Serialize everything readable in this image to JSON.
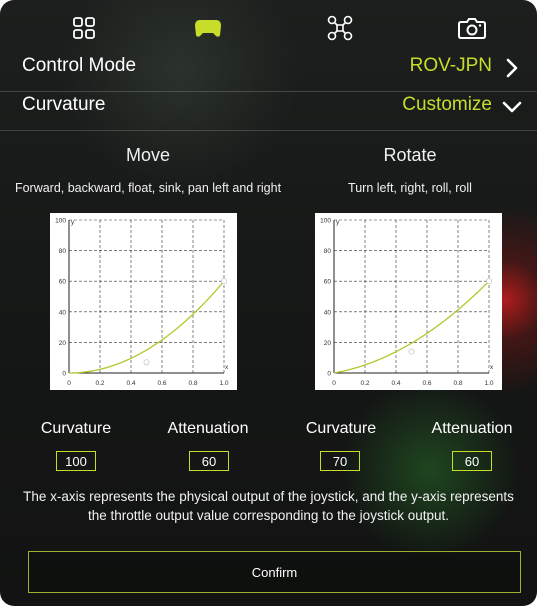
{
  "tabs": [
    {
      "icon": "grid-icon",
      "active": false
    },
    {
      "icon": "gamepad-icon",
      "active": true
    },
    {
      "icon": "drone-icon",
      "active": false
    },
    {
      "icon": "camera-icon",
      "active": false
    }
  ],
  "control_mode": {
    "label": "Control Mode",
    "value": "ROV-JPN"
  },
  "curvature_row": {
    "label": "Curvature",
    "value": "Customize"
  },
  "colors": {
    "accent": "#c8dd2a",
    "curve": "#b7c62b",
    "border": "#9fb02a"
  },
  "move_chart": {
    "title": "Move",
    "description": "Forward, backward, float, sink, pan left and right",
    "x_label": "x",
    "y_label": "y",
    "x_ticks": [
      "0",
      "0.2",
      "0.4",
      "0.6",
      "0.8",
      "1.0"
    ],
    "y_ticks": [
      "0",
      "20",
      "40",
      "60",
      "80",
      "100"
    ],
    "curvature": 100,
    "attenuation": 60,
    "marker": {
      "x": 0.5,
      "y": 7
    }
  },
  "rotate_chart": {
    "title": "Rotate",
    "description": "Turn left, right, roll, roll",
    "x_label": "x",
    "y_label": "y",
    "x_ticks": [
      "0",
      "0.2",
      "0.4",
      "0.6",
      "0.8",
      "1.0"
    ],
    "y_ticks": [
      "0",
      "20",
      "40",
      "60",
      "80",
      "100"
    ],
    "curvature": 70,
    "attenuation": 60,
    "marker": {
      "x": 0.5,
      "y": 14
    }
  },
  "params": {
    "curvature_label": "Curvature",
    "attenuation_label": "Attenuation",
    "move_curvature": "100",
    "move_attenuation": "60",
    "rotate_curvature": "70",
    "rotate_attenuation": "60"
  },
  "note": "The x-axis represents the physical output of the joystick, and the y-axis represents the throttle output value corresponding to the joystick output.",
  "confirm_label": "Confirm"
}
